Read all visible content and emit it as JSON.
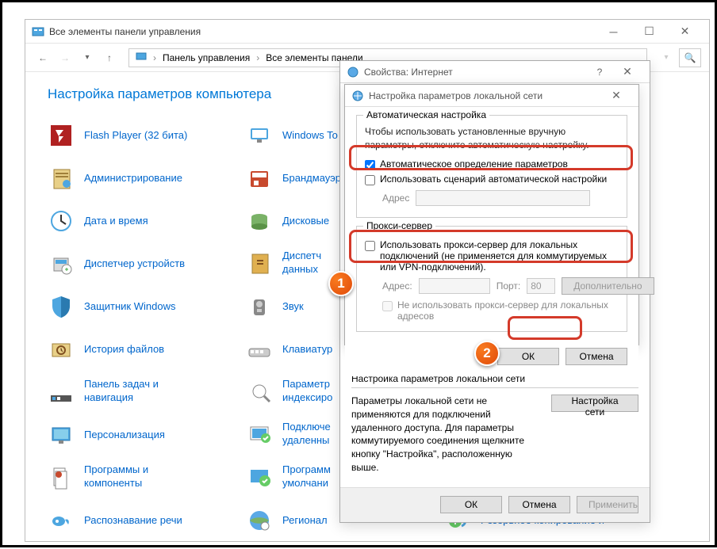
{
  "mainWindow": {
    "title": "Все элементы панели управления",
    "breadcrumb": {
      "part1": "Панель управления",
      "part2": "Все элементы панели"
    },
    "heading": "Настройка параметров компьютера",
    "items": [
      {
        "label": "Flash Player (32 бита)"
      },
      {
        "label": "Windows To"
      },
      {
        "label": "Администрирование"
      },
      {
        "label": "Брандмауэр"
      },
      {
        "label": "Дата и время"
      },
      {
        "label": "Дисковые"
      },
      {
        "label": "Диспетчер устройств"
      },
      {
        "label": "Диспетч\nданных"
      },
      {
        "label": "Защитник Windows"
      },
      {
        "label": "Звук"
      },
      {
        "label": "История файлов"
      },
      {
        "label": "Клавиатур"
      },
      {
        "label": "Панель задач и\nнавигация"
      },
      {
        "label": "Параметр\nиндексиро"
      },
      {
        "label": "Персонализация"
      },
      {
        "label": "Подключе\nудаленны"
      },
      {
        "label": "Программы и\nкомпоненты"
      },
      {
        "label": "Программ\nумолчани"
      },
      {
        "label": "Распознавание речи"
      },
      {
        "label": "Регионал"
      },
      {
        "label": "Резервное копирование и"
      }
    ]
  },
  "internetDialog": {
    "title": "Свойства: Интернет",
    "lanSection": {
      "heading": "Настройка параметров локальной сети",
      "text": "Параметры локальной сети не применяются для подключений удаленного доступа. Для параметры коммутируемого соединения щелкните кнопку \"Настройка\", расположенную выше.",
      "btn": "Настройка сети"
    },
    "footer": {
      "ok": "ОК",
      "cancel": "Отмена",
      "apply": "Применить"
    }
  },
  "lanDialog": {
    "title": "Настройка параметров локальной сети",
    "auto": {
      "groupTitle": "Автоматическая настройка",
      "text": "Чтобы использовать установленные вручную параметры, отключите автоматическую настройку.",
      "chk1": "Автоматическое определение параметров",
      "chk2": "Использовать сценарий автоматической настройки",
      "addrLabel": "Адрес"
    },
    "proxy": {
      "groupTitle": "Прокси-сервер",
      "chk": "Использовать прокси-сервер для локальных подключений (не применяется для коммутируемых или VPN-подключений).",
      "addrLabel": "Адрес:",
      "portLabel": "Порт:",
      "portValue": "80",
      "advBtn": "Дополнительно",
      "bypass": "Не использовать прокси-сервер для локальных адресов"
    },
    "footer": {
      "ok": "ОК",
      "cancel": "Отмена"
    }
  },
  "callouts": {
    "c1": "1",
    "c2": "2"
  }
}
